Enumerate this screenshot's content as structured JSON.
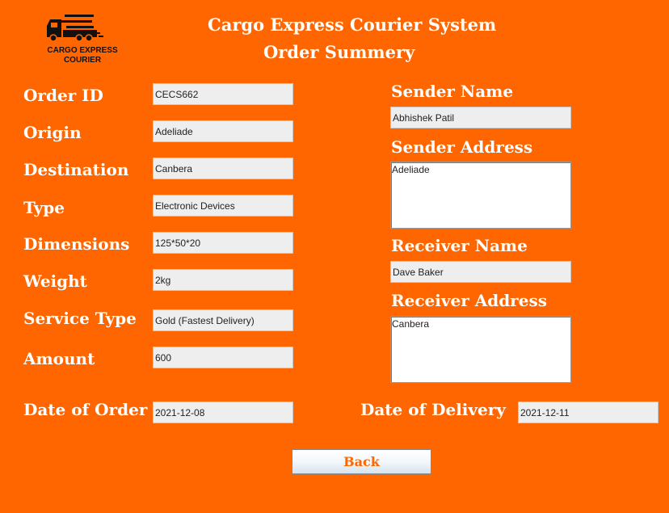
{
  "header": {
    "title": "Cargo Express Courier System",
    "subtitle": "Order Summery",
    "logo_text_line1": "CARGO EXPRESS",
    "logo_text_line2": "COURIER"
  },
  "order": {
    "order_id_label": "Order ID",
    "order_id_value": "CECS662",
    "origin_label": "Origin",
    "origin_value": "Adeliade",
    "destination_label": "Destination",
    "destination_value": "Canbera",
    "type_label": "Type",
    "type_value": "Electronic Devices",
    "dimensions_label": "Dimensions",
    "dimensions_value": "125*50*20",
    "weight_label": "Weight",
    "weight_value": "2kg",
    "service_type_label": "Service Type",
    "service_type_value": "Gold (Fastest Delivery)",
    "amount_label": "Amount",
    "amount_value": "600",
    "date_of_order_label": "Date of Order",
    "date_of_order_value": "2021-12-08",
    "date_of_delivery_label": "Date of Delivery",
    "date_of_delivery_value": "2021-12-11"
  },
  "sender": {
    "name_label": "Sender Name",
    "name_value": "Abhishek Patil",
    "address_label": "Sender Address",
    "address_value": "Adeliade"
  },
  "receiver": {
    "name_label": "Receiver Name",
    "name_value": "Dave Baker",
    "address_label": "Receiver Address",
    "address_value": "Canbera"
  },
  "actions": {
    "back_label": "Back"
  },
  "colors": {
    "background": "#ff6600",
    "label_text": "#ffffff",
    "button_text": "#ff6600"
  }
}
